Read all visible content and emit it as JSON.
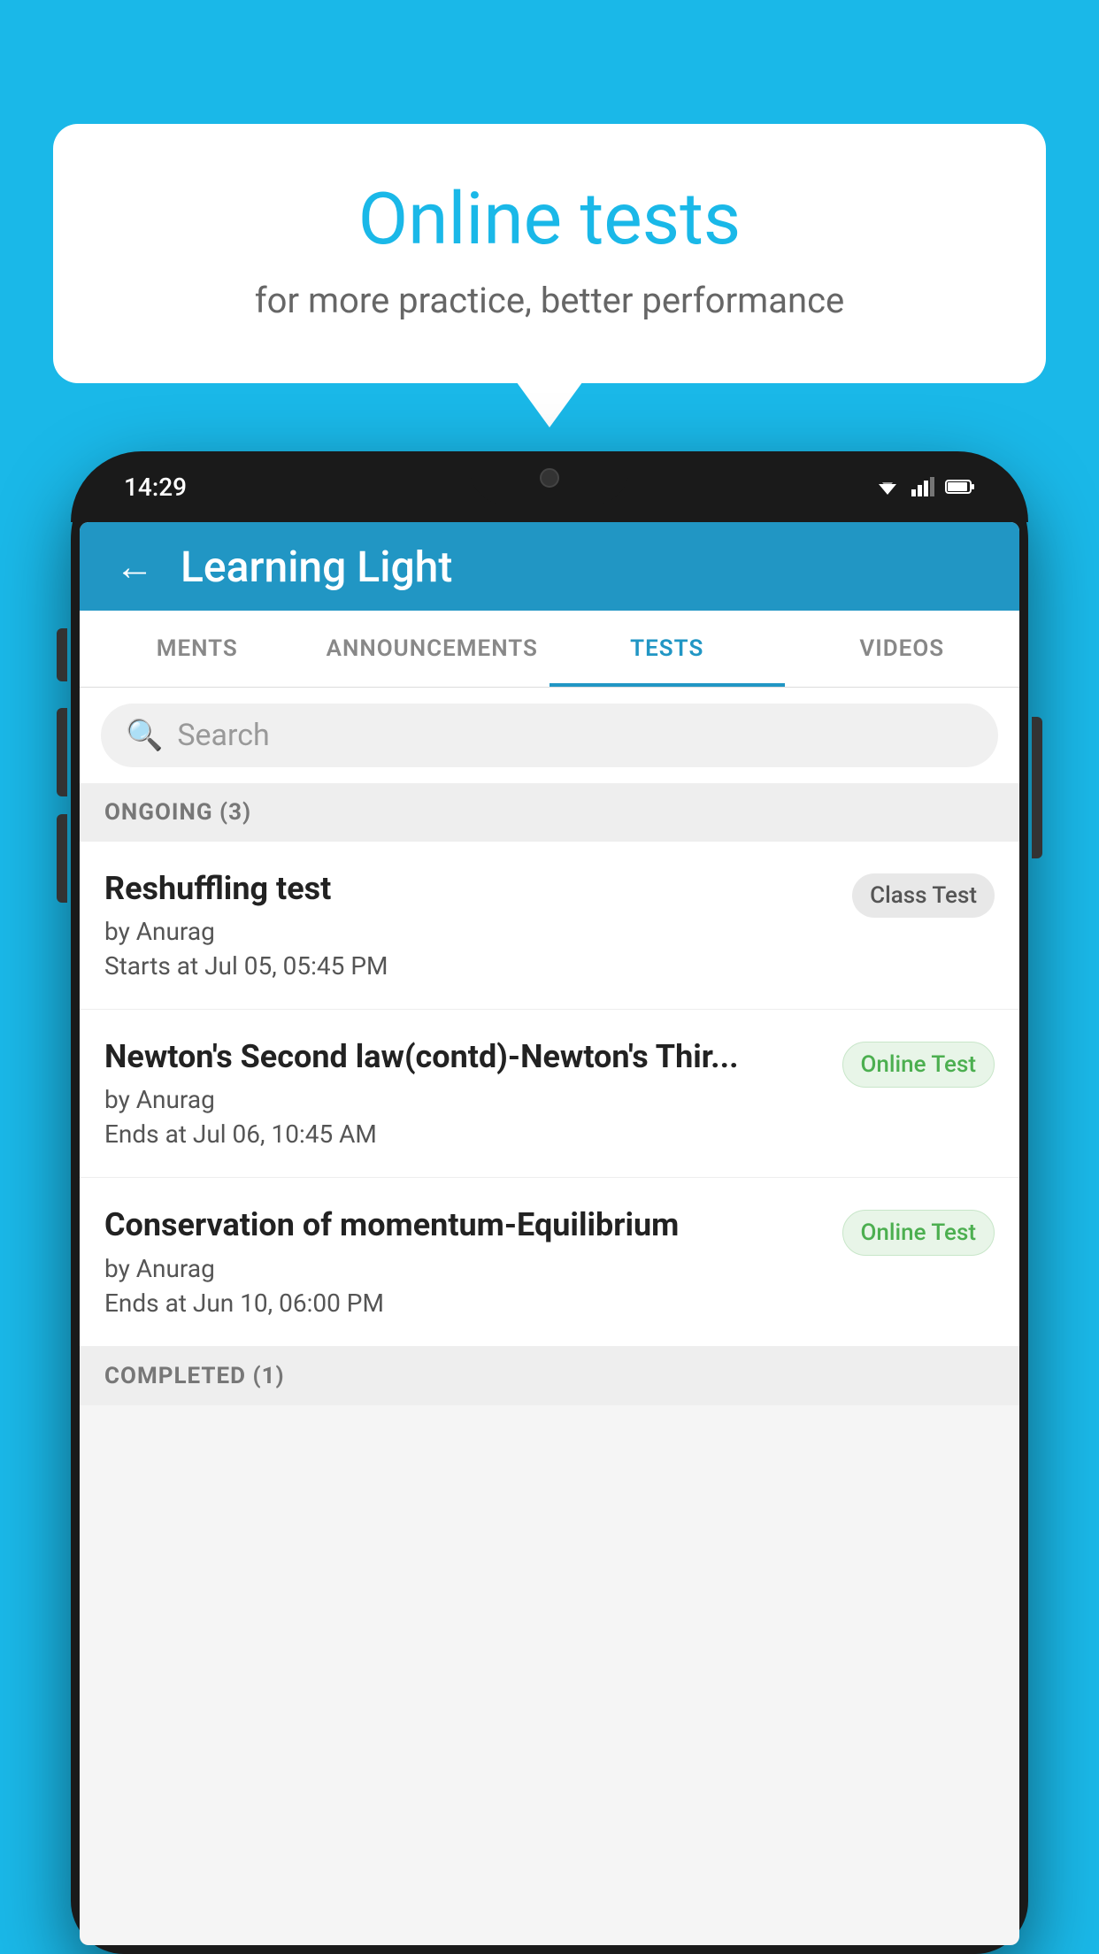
{
  "background_color": "#1ab8e8",
  "bubble": {
    "title": "Online tests",
    "subtitle": "for more practice, better performance"
  },
  "phone": {
    "time": "14:29",
    "app_name": "Learning Light",
    "tabs": [
      {
        "label": "MENTS",
        "active": false
      },
      {
        "label": "ANNOUNCEMENTS",
        "active": false
      },
      {
        "label": "TESTS",
        "active": true
      },
      {
        "label": "VIDEOS",
        "active": false
      }
    ],
    "search_placeholder": "Search",
    "ongoing_section": "ONGOING (3)",
    "completed_section": "COMPLETED (1)",
    "tests": [
      {
        "title": "Reshuffling test",
        "author": "by Anurag",
        "date": "Starts at  Jul 05, 05:45 PM",
        "badge": "Class Test",
        "badge_type": "class"
      },
      {
        "title": "Newton's Second law(contd)-Newton's Thir...",
        "author": "by Anurag",
        "date": "Ends at  Jul 06, 10:45 AM",
        "badge": "Online Test",
        "badge_type": "online"
      },
      {
        "title": "Conservation of momentum-Equilibrium",
        "author": "by Anurag",
        "date": "Ends at  Jun 10, 06:00 PM",
        "badge": "Online Test",
        "badge_type": "online"
      }
    ]
  }
}
